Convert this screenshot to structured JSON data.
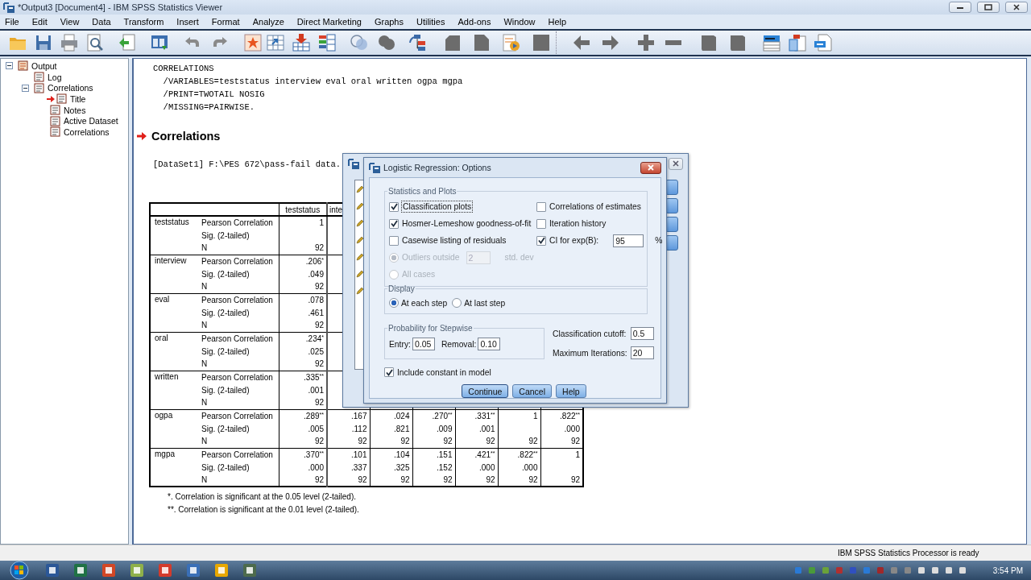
{
  "window": {
    "title": "*Output3 [Document4] - IBM SPSS Statistics Viewer"
  },
  "menu": [
    "File",
    "Edit",
    "View",
    "Data",
    "Transform",
    "Insert",
    "Format",
    "Analyze",
    "Direct Marketing",
    "Graphs",
    "Utilities",
    "Add-ons",
    "Window",
    "Help"
  ],
  "outline": [
    {
      "label": "Output",
      "expanded": true,
      "current": false,
      "children": [
        {
          "label": "Log",
          "current": false
        },
        {
          "label": "Correlations",
          "expanded": true,
          "current": false,
          "children": [
            {
              "label": "Title",
              "current": true
            },
            {
              "label": "Notes",
              "current": false
            },
            {
              "label": "Active Dataset",
              "current": false
            },
            {
              "label": "Correlations",
              "current": false
            }
          ]
        }
      ]
    }
  ],
  "output": {
    "syntax": [
      "CORRELATIONS",
      "  /VARIABLES=teststatus interview eval oral written ogpa mgpa",
      "  /PRINT=TWOTAIL NOSIG",
      "  /MISSING=PAIRWISE."
    ],
    "heading": "Correlations",
    "dataset": "[DataSet1] F:\\PES 672\\pass-fail data.",
    "table": {
      "columns": [
        "teststatus",
        "inte"
      ],
      "rows": [
        {
          "variable": "teststatus",
          "stats": [
            {
              "label": "Pearson Correlation",
              "values": [
                "1"
              ]
            },
            {
              "label": "Sig. (2-tailed)"
            },
            {
              "label": "N",
              "values": [
                "92"
              ]
            }
          ]
        },
        {
          "variable": "interview",
          "stats": [
            {
              "label": "Pearson Correlation",
              "values": [
                ".206$^{*}$"
              ]
            },
            {
              "label": "Sig. (2-tailed)",
              "values": [
                ".049"
              ]
            },
            {
              "label": "N",
              "values": [
                "92"
              ]
            }
          ]
        },
        {
          "variable": "eval",
          "stats": [
            {
              "label": "Pearson Correlation",
              "values": [
                ".078"
              ]
            },
            {
              "label": "Sig. (2-tailed)",
              "values": [
                ".461"
              ]
            },
            {
              "label": "N",
              "values": [
                "92"
              ]
            }
          ]
        },
        {
          "variable": "oral",
          "stats": [
            {
              "label": "Pearson Correlation",
              "values": [
                ".234$^{*}$"
              ]
            },
            {
              "label": "Sig. (2-tailed)",
              "values": [
                ".025"
              ]
            },
            {
              "label": "N",
              "values": [
                "92"
              ]
            }
          ]
        },
        {
          "variable": "written",
          "stats": [
            {
              "label": "Pearson Correlation",
              "values": [
                ".335$^{**}$"
              ]
            },
            {
              "label": "Sig. (2-tailed)",
              "values": [
                ".001"
              ]
            },
            {
              "label": "N",
              "values": [
                "92"
              ]
            }
          ]
        },
        {
          "variable": "ogpa",
          "stats": [
            {
              "label": "Pearson Correlation",
              "values": [
                ".289$^{**}$",
                ".167",
                ".024",
                ".270$^{**}$",
                ".331$^{**}$",
                "1",
                ".822$^{**}$"
              ]
            },
            {
              "label": "Sig. (2-tailed)",
              "values": [
                ".005",
                ".112",
                ".821",
                ".009",
                ".001",
                ".000"
              ]
            },
            {
              "label": "N",
              "values": [
                "92",
                "92",
                "92",
                "92",
                "92",
                "92",
                "92"
              ]
            }
          ]
        },
        {
          "variable": "mgpa",
          "stats": [
            {
              "label": "Pearson Correlation",
              "values": [
                ".370$^{**}$",
                ".101",
                ".104",
                ".151",
                ".421$^{**}$",
                ".822$^{**}$",
                "1"
              ]
            },
            {
              "label": "Sig. (2-tailed)",
              "values": [
                ".000",
                ".337",
                ".325",
                ".152",
                ".000",
                ".000"
              ]
            },
            {
              "label": "N",
              "values": [
                "92",
                "92",
                "92",
                "92",
                "92",
                "92",
                "92"
              ]
            }
          ]
        }
      ]
    },
    "footnotes": [
      "*. Correlation is significant at the 0.05 level (2-tailed).",
      "**. Correlation is significant at the 0.01 level (2-tailed)."
    ]
  },
  "dialog": {
    "title": "Logistic Regression: Options",
    "statistics": {
      "legend": "Statistics and Plots",
      "left": [
        {
          "kind": "checkbox",
          "label": "Classification plots",
          "checked": true,
          "focused": true,
          "disabled": false
        },
        {
          "kind": "checkbox",
          "label": "Hosmer-Lemeshow goodness-of-fit",
          "checked": true,
          "focused": false,
          "disabled": false
        },
        {
          "kind": "checkbox",
          "label": "Casewise listing of residuals",
          "checked": false,
          "focused": false,
          "disabled": false
        },
        {
          "kind": "radio",
          "label": "Outliers outside",
          "selected": true,
          "focused": false,
          "disabled": true,
          "value": "2",
          "suffix": "std. dev"
        },
        {
          "kind": "radio",
          "label": "All cases",
          "selected": false,
          "focused": false,
          "disabled": true
        }
      ],
      "right": [
        {
          "kind": "checkbox",
          "label": "Correlations of estimates",
          "checked": false,
          "focused": false,
          "disabled": false
        },
        {
          "kind": "checkbox",
          "label": "Iteration history",
          "checked": false,
          "focused": false,
          "disabled": false
        },
        {
          "kind": "checkbox",
          "label": "CI for exp(B):",
          "checked": true,
          "focused": false,
          "disabled": false,
          "value": "95",
          "suffix": "%"
        }
      ]
    },
    "display": {
      "legend": "Display",
      "options": [
        {
          "label": "At each step",
          "selected": true
        },
        {
          "label": "At last step",
          "selected": false
        }
      ]
    },
    "stepwise": {
      "legend": "Probability for Stepwise",
      "fields": [
        {
          "label": "Entry:",
          "value": "0.05"
        },
        {
          "label": "Removal:",
          "value": "0.10"
        }
      ]
    },
    "settings": [
      {
        "label": "Classification cutoff:",
        "value": "0.5"
      },
      {
        "label": "Maximum Iterations:",
        "value": "20"
      }
    ],
    "constant": {
      "label": "Include constant in model",
      "checked": true
    },
    "buttons": [
      {
        "label": "Continue",
        "default": true
      },
      {
        "label": "Cancel",
        "default": false
      },
      {
        "label": "Help",
        "default": false
      }
    ]
  },
  "status_bar": {
    "message": "IBM SPSS Statistics Processor is ready"
  },
  "taskbar": {
    "time": "3:54 PM"
  }
}
